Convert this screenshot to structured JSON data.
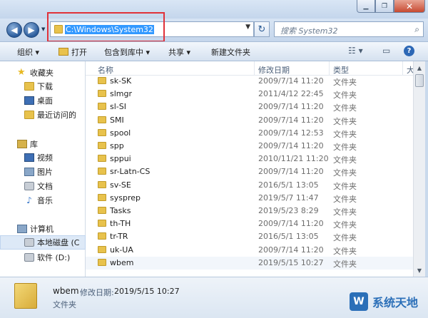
{
  "address": {
    "path": "C:\\Windows\\System32",
    "search_placeholder": "搜索 System32"
  },
  "toolbar": {
    "organize": "组织 ▾",
    "open": "打开",
    "include_in_library": "包含到库中 ▾",
    "share": "共享 ▾",
    "new_folder": "新建文件夹"
  },
  "columns": {
    "name": "名称",
    "date": "修改日期",
    "type": "类型",
    "size": "大"
  },
  "nav": {
    "favorites": "收藏夹",
    "downloads": "下载",
    "desktop": "桌面",
    "recent": "最近访问的",
    "libraries": "库",
    "videos": "视频",
    "pictures": "图片",
    "documents": "文档",
    "music": "音乐",
    "computer": "计算机",
    "local_disk": "本地磁盘 (C",
    "software_drive": "软件 (D:)"
  },
  "files": [
    {
      "name": "sk-SK",
      "date": "2009/7/14 11:20",
      "type": "文件夹"
    },
    {
      "name": "slmgr",
      "date": "2011/4/12 22:45",
      "type": "文件夹"
    },
    {
      "name": "sl-SI",
      "date": "2009/7/14 11:20",
      "type": "文件夹"
    },
    {
      "name": "SMI",
      "date": "2009/7/14 11:20",
      "type": "文件夹"
    },
    {
      "name": "spool",
      "date": "2009/7/14 12:53",
      "type": "文件夹"
    },
    {
      "name": "spp",
      "date": "2009/7/14 11:20",
      "type": "文件夹"
    },
    {
      "name": "sppui",
      "date": "2010/11/21 11:20",
      "type": "文件夹"
    },
    {
      "name": "sr-Latn-CS",
      "date": "2009/7/14 11:20",
      "type": "文件夹"
    },
    {
      "name": "sv-SE",
      "date": "2016/5/1 13:05",
      "type": "文件夹"
    },
    {
      "name": "sysprep",
      "date": "2019/5/7 11:47",
      "type": "文件夹"
    },
    {
      "name": "Tasks",
      "date": "2019/5/23 8:29",
      "type": "文件夹"
    },
    {
      "name": "th-TH",
      "date": "2009/7/14 11:20",
      "type": "文件夹"
    },
    {
      "name": "tr-TR",
      "date": "2016/5/1 13:05",
      "type": "文件夹"
    },
    {
      "name": "uk-UA",
      "date": "2009/7/14 11:20",
      "type": "文件夹"
    },
    {
      "name": "wbem",
      "date": "2019/5/15 10:27",
      "type": "文件夹"
    }
  ],
  "details": {
    "name": "wbem",
    "date_label": "修改日期:",
    "date_value": "2019/5/15 10:27",
    "type": "文件夹"
  },
  "watermark": {
    "logo": "W",
    "text": "系统天地"
  },
  "colors": {
    "accent": "#3399ff",
    "highlight_box": "#e0313a",
    "folder": "#e8c24c"
  }
}
